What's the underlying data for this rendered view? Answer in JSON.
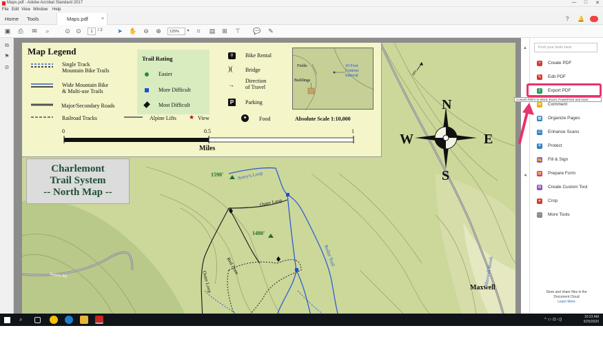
{
  "window": {
    "title": "Maps.pdf - Adobe Acrobat Standard 2017",
    "controls": [
      "—",
      "□",
      "✕"
    ]
  },
  "menu": [
    "File",
    "Edit",
    "View",
    "Window",
    "Help"
  ],
  "tabs": {
    "home": "Home",
    "tools": "Tools",
    "document": "Maps.pdf",
    "close": "×"
  },
  "toolbar": {
    "page_current": "1",
    "page_total": "/ 2",
    "zoom": "125%",
    "icons": [
      "save-icon",
      "print-icon",
      "mail-icon",
      "search-icon",
      "previous-page-icon",
      "next-page-icon",
      "select-icon",
      "hand-icon",
      "zoom-out-icon",
      "zoom-in-icon",
      "zoom-dropdown-icon",
      "crop-icon",
      "scroll-icon",
      "fit-page-icon",
      "stamp-icon",
      "comment-icon",
      "pen-icon"
    ]
  },
  "right_panel": {
    "search_placeholder": "Find your tools here",
    "tools": [
      {
        "label": "Create PDF",
        "icon": "create-pdf-icon",
        "color": "#d83a2f"
      },
      {
        "label": "Edit PDF",
        "icon": "edit-pdf-icon",
        "color": "#d83a2f"
      },
      {
        "label": "Export PDF",
        "icon": "export-pdf-icon",
        "color": "#2e9a57"
      },
      {
        "label": "Comment",
        "icon": "comment-icon",
        "color": "#e3b11f"
      },
      {
        "label": "Organize Pages",
        "icon": "organize-pages-icon",
        "color": "#2f7fc1"
      },
      {
        "label": "Enhance Scans",
        "icon": "enhance-scans-icon",
        "color": "#2f7fc1"
      },
      {
        "label": "Protect",
        "icon": "protect-icon",
        "color": "#2f7fc1"
      },
      {
        "label": "Fill & Sign",
        "icon": "fill-sign-icon",
        "color": "#8c52c4"
      },
      {
        "label": "Prepare Form",
        "icon": "prepare-form-icon",
        "color": "#d83a2f"
      },
      {
        "label": "Create Custom Tool",
        "icon": "custom-tool-icon",
        "color": "#8c52c4"
      },
      {
        "label": "Crop",
        "icon": "crop-icon",
        "color": "#d83a2f"
      },
      {
        "label": "More Tools",
        "icon": "more-tools-icon",
        "color": "#888888"
      }
    ],
    "tooltip": "Convert PDFs to Word, Excel, PowerPoint and more",
    "footer_line1": "Store and share files in the",
    "footer_line2": "Document Cloud",
    "footer_link": "Learn More",
    "highlight_color": "#e8336b"
  },
  "map": {
    "legend_title": "Map Legend",
    "single_track": "Single Track",
    "mtb_trails": "Mountain Bike Trails",
    "wide_mtb": "Wide Mountain Bike",
    "multi_use": "& Multi-use Trails",
    "major_roads": "Major/Secondary Roads",
    "railroad": "Railroad Tracks",
    "alpine": "Alpine Lifts",
    "view": "View",
    "trail_rating": "Trail Rating",
    "easier": "Easier",
    "more_difficult": "More Difficult",
    "most_difficult": "Most Difficult",
    "bike_rental": "Bike Rental",
    "bridge": "Bridge",
    "direction_line1": "Direction",
    "direction_line2": "of Travel",
    "parking": "Parking",
    "food": "Food",
    "scale": "Absolute Scale  1:10,000",
    "scale_0": "0",
    "scale_05": "0.5",
    "scale_1": "1",
    "miles": "Miles",
    "inset_fields": "Fields",
    "inset_buildings": "Buildings",
    "inset_contour_line1": "10 Foot",
    "inset_contour_line2": "Contour",
    "inset_contour_line3": "Interval",
    "compass_n": "N",
    "compass_s": "S",
    "compass_e": "E",
    "compass_w": "W",
    "mn": "MN",
    "system_line1": "Charlemont",
    "system_line2": "Trail System",
    "system_line3": "-- North Map --",
    "elev_1590": "1590'",
    "elev_1480": "1480'",
    "averys_loop": "Avery's Loop",
    "outer_loop": "Outer Loop",
    "roller_trail": "Roller Trail",
    "red_zone": "Red Zone",
    "outer_loop_2": "Outer Loop",
    "maxwell_brook": "Maxwell Brook",
    "maxwell": "Maxwell",
    "potters_rd": "Potters Rd"
  },
  "taskbar": {
    "time": "10:23 AM",
    "date": "5/25/2020"
  }
}
